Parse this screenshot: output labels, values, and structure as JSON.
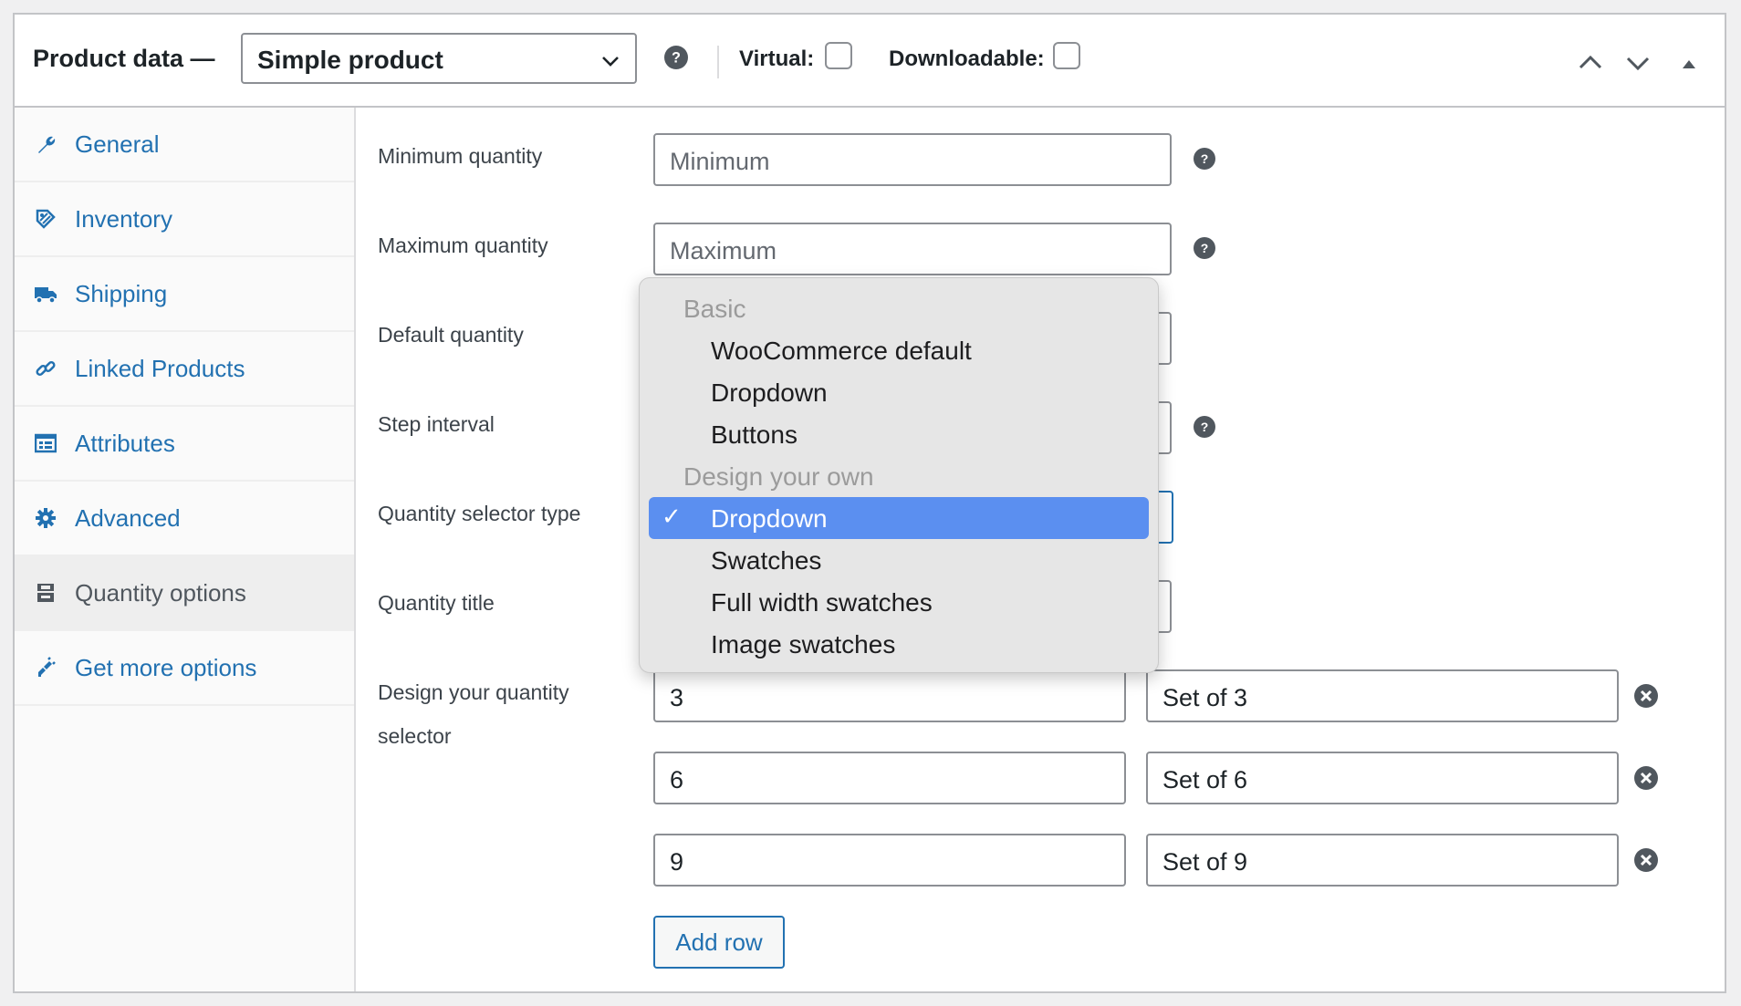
{
  "header": {
    "title": "Product data —",
    "product_type": "Simple product",
    "virtual_label": "Virtual:",
    "downloadable_label": "Downloadable:"
  },
  "sidebar": {
    "items": [
      {
        "label": "General",
        "icon": "wrench-icon"
      },
      {
        "label": "Inventory",
        "icon": "tag-icon"
      },
      {
        "label": "Shipping",
        "icon": "truck-icon"
      },
      {
        "label": "Linked Products",
        "icon": "link-icon"
      },
      {
        "label": "Attributes",
        "icon": "list-view-icon"
      },
      {
        "label": "Advanced",
        "icon": "gear-icon"
      },
      {
        "label": "Quantity options",
        "icon": "quantity-icon",
        "active": true
      },
      {
        "label": "Get more options",
        "icon": "plugin-icon"
      }
    ]
  },
  "form": {
    "min_label": "Minimum quantity",
    "min_placeholder": "Minimum",
    "max_label": "Maximum quantity",
    "max_placeholder": "Maximum",
    "default_label": "Default quantity",
    "step_label": "Step interval",
    "selector_type_label": "Quantity selector type",
    "title_label": "Quantity title",
    "design_label_1": "Design your quantity",
    "design_label_2": "selector",
    "rows": [
      {
        "quantity": "3",
        "label": "Set of 3"
      },
      {
        "quantity": "6",
        "label": "Set of 6"
      },
      {
        "quantity": "9",
        "label": "Set of 9"
      }
    ],
    "add_row_label": "Add row"
  },
  "dropdown": {
    "group_basic": "Basic",
    "basic_options": [
      "WooCommerce default",
      "Dropdown",
      "Buttons"
    ],
    "group_custom": "Design your own",
    "custom_options": [
      "Dropdown",
      "Swatches",
      "Full width swatches",
      "Image swatches"
    ],
    "selected": "Dropdown",
    "check_glyph": "✓"
  },
  "colors": {
    "link": "#2271b1",
    "selected_bg": "#5b8ff0"
  }
}
